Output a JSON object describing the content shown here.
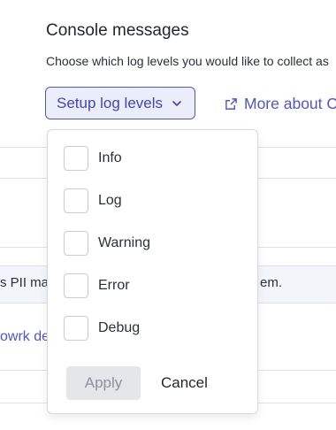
{
  "section": {
    "title": "Console messages",
    "description": "Choose which log levels you would like to collect as"
  },
  "setup_button": {
    "label": "Setup log levels",
    "icon": "chevron-down-icon"
  },
  "more_link": {
    "label": "More about C",
    "icon": "external-link-icon"
  },
  "background": {
    "row_left_text": "s PII ma",
    "row_right_text": "em.",
    "link_text": "owrk de"
  },
  "dropdown": {
    "options": [
      {
        "label": "Info",
        "checked": false
      },
      {
        "label": "Log",
        "checked": false
      },
      {
        "label": "Warning",
        "checked": false
      },
      {
        "label": "Error",
        "checked": false
      },
      {
        "label": "Debug",
        "checked": false
      }
    ],
    "apply_label": "Apply",
    "apply_disabled": true,
    "cancel_label": "Cancel"
  },
  "colors": {
    "accent": "#4f55c9",
    "accent_bg": "#ecedfb",
    "disabled_bg": "#e4e6ea"
  }
}
